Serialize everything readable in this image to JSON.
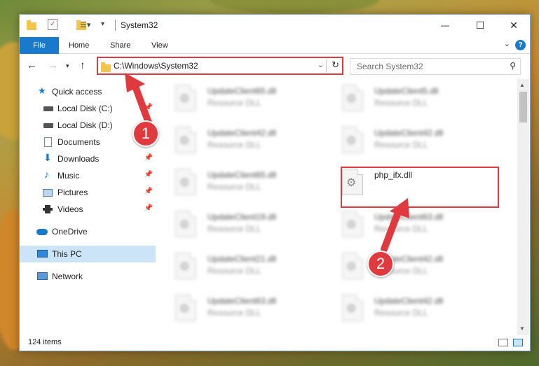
{
  "window": {
    "title": "System32",
    "minimize": "—",
    "maximize": "☐",
    "close": "✕"
  },
  "ribbon": {
    "file": "File",
    "home": "Home",
    "share": "Share",
    "view": "View",
    "help": "?"
  },
  "address": {
    "path": "C:\\Windows\\System32",
    "search_placeholder": "Search System32"
  },
  "sidebar": {
    "items": [
      {
        "label": "Quick access"
      },
      {
        "label": "Local Disk (C:)"
      },
      {
        "label": "Local Disk (D:)"
      },
      {
        "label": "Documents"
      },
      {
        "label": "Downloads"
      },
      {
        "label": "Music"
      },
      {
        "label": "Pictures"
      },
      {
        "label": "Videos"
      },
      {
        "label": "OneDrive"
      },
      {
        "label": "This PC"
      },
      {
        "label": "Network"
      }
    ]
  },
  "files": {
    "left": [
      {
        "name": "UpdateClient65.dll",
        "type": "Resource DLL"
      },
      {
        "name": "UpdateClient42.dll",
        "type": "Resource DLL"
      },
      {
        "name": "UpdateClient65.dll",
        "type": "Resource DLL"
      },
      {
        "name": "UpdateClient19.dll",
        "type": "Resource DLL"
      },
      {
        "name": "UpdateClient21.dll",
        "type": "Resource DLL"
      },
      {
        "name": "UpdateClient63.dll",
        "type": "Resource DLL"
      }
    ],
    "right": [
      {
        "name": "UpdateClient5.dll",
        "type": "Resource DLL"
      },
      {
        "name": "UpdateClient42.dll",
        "type": "Resource DLL"
      },
      {
        "name": "php_ifx.dll",
        "type": ""
      },
      {
        "name": "UpdateClient63.dll",
        "type": "Resource DLL"
      },
      {
        "name": "UpdateClient42.dll",
        "type": "Resource DLL"
      },
      {
        "name": "UpdateClient42.dll",
        "type": "Resource DLL"
      }
    ]
  },
  "status": {
    "count": "124 items"
  },
  "callouts": {
    "one": "1",
    "two": "2"
  },
  "colors": {
    "accent": "#1979ca",
    "highlight": "#e0393e",
    "selected": "#cce4f7"
  }
}
